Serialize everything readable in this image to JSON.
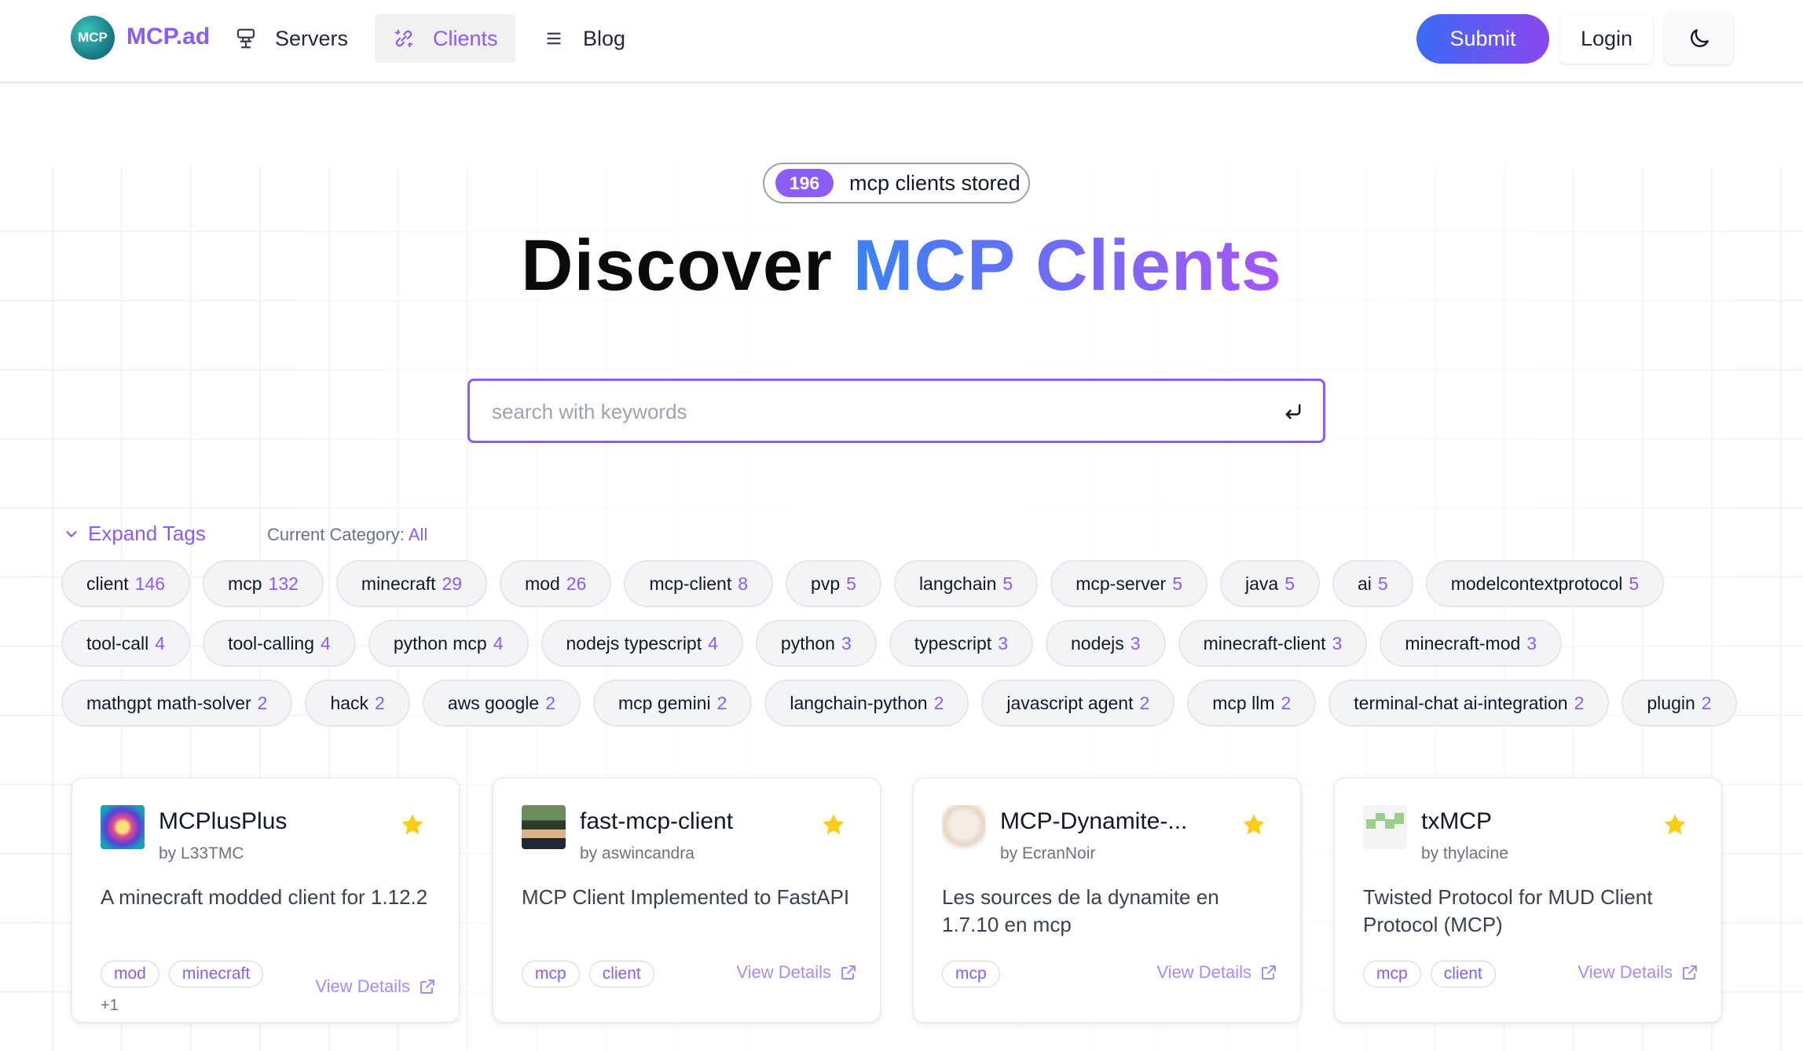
{
  "header": {
    "logo_text": "MCP",
    "brand": "MCP.ad",
    "nav": [
      {
        "label": "Servers",
        "icon": "server-icon"
      },
      {
        "label": "Clients",
        "icon": "link-icon",
        "active": true
      },
      {
        "label": "Blog",
        "icon": "menu-lines-icon"
      }
    ],
    "submit_label": "Submit",
    "login_label": "Login",
    "theme_icon": "moon-icon"
  },
  "hero": {
    "count": "196",
    "count_label": "mcp clients stored",
    "title_dark": "Discover",
    "title_accent": "MCP Clients",
    "search_placeholder": "search with keywords"
  },
  "filters": {
    "expand_label": "Expand Tags",
    "current_category_label": "Current Category:",
    "current_category_value": "All"
  },
  "tags": [
    [
      {
        "name": "client",
        "count": "146"
      },
      {
        "name": "mcp",
        "count": "132"
      },
      {
        "name": "minecraft",
        "count": "29"
      },
      {
        "name": "mod",
        "count": "26"
      },
      {
        "name": "mcp-client",
        "count": "8"
      },
      {
        "name": "pvp",
        "count": "5"
      },
      {
        "name": "langchain",
        "count": "5"
      },
      {
        "name": "mcp-server",
        "count": "5"
      },
      {
        "name": "java",
        "count": "5"
      },
      {
        "name": "ai",
        "count": "5"
      },
      {
        "name": "modelcontextprotocol",
        "count": "5"
      }
    ],
    [
      {
        "name": "tool-call",
        "count": "4"
      },
      {
        "name": "tool-calling",
        "count": "4"
      },
      {
        "name": "python mcp",
        "count": "4"
      },
      {
        "name": "nodejs typescript",
        "count": "4"
      },
      {
        "name": "python",
        "count": "3"
      },
      {
        "name": "typescript",
        "count": "3"
      },
      {
        "name": "nodejs",
        "count": "3"
      },
      {
        "name": "minecraft-client",
        "count": "3"
      },
      {
        "name": "minecraft-mod",
        "count": "3"
      }
    ],
    [
      {
        "name": "mathgpt math-solver",
        "count": "2"
      },
      {
        "name": "hack",
        "count": "2"
      },
      {
        "name": "aws google",
        "count": "2"
      },
      {
        "name": "mcp gemini",
        "count": "2"
      },
      {
        "name": "langchain-python",
        "count": "2"
      },
      {
        "name": "javascript agent",
        "count": "2"
      },
      {
        "name": "mcp llm",
        "count": "2"
      },
      {
        "name": "terminal-chat ai-integration",
        "count": "2"
      },
      {
        "name": "plugin",
        "count": "2"
      }
    ]
  ],
  "cards": [
    {
      "title": "MCPlusPlus",
      "author": "by L33TMC",
      "description": "A minecraft modded client for 1.12.2",
      "tags": [
        "mod",
        "minecraft"
      ],
      "more": "+1",
      "link_label": "View Details"
    },
    {
      "title": "fast-mcp-client",
      "author": "by aswincandra",
      "description": "MCP Client Implemented to FastAPI",
      "tags": [
        "mcp",
        "client"
      ],
      "more": "",
      "link_label": "View Details"
    },
    {
      "title": "MCP-Dynamite-...",
      "author": "by EcranNoir",
      "description": "Les sources de la dynamite en 1.7.10 en mcp",
      "tags": [
        "mcp"
      ],
      "more": "",
      "link_label": "View Details"
    },
    {
      "title": "txMCP",
      "author": "by thylacine",
      "description": "Twisted Protocol for MUD Client Protocol (MCP)",
      "tags": [
        "mcp",
        "client"
      ],
      "more": "",
      "link_label": "View Details"
    }
  ],
  "colors": {
    "accent": "#8b5cf6",
    "gradient_start": "#3b82f6",
    "gradient_end": "#a855f7",
    "star": "#facc15"
  }
}
